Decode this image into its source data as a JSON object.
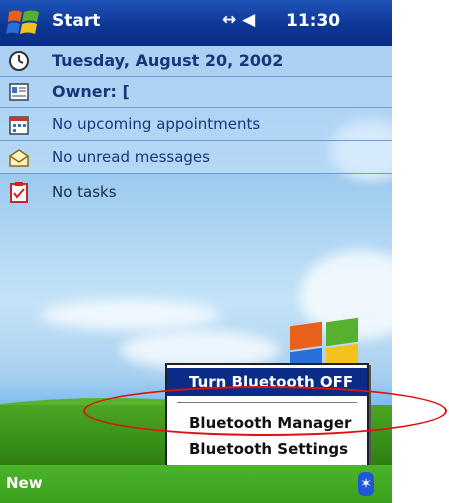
{
  "title_bar": {
    "title": "Start",
    "status_icons": "↔ ◀",
    "clock": "11:30"
  },
  "today": {
    "date": "Tuesday, August 20, 2002",
    "owner": "Owner: [",
    "appointments": "No upcoming appointments",
    "messages": "No unread messages",
    "tasks": "No tasks"
  },
  "menu": {
    "items": [
      {
        "label": "Turn Bluetooth OFF",
        "selected": true
      },
      {
        "label": "Bluetooth Manager",
        "selected": false
      },
      {
        "label": "Bluetooth Settings",
        "selected": false
      }
    ]
  },
  "command_bar": {
    "new_label": "New",
    "tray_icon": "bluetooth-icon"
  },
  "colors": {
    "title_bar": "#0c3594",
    "command_bar": "#3aa01e",
    "menu_selection": "#0a2c86",
    "annotation": "#e01010"
  }
}
